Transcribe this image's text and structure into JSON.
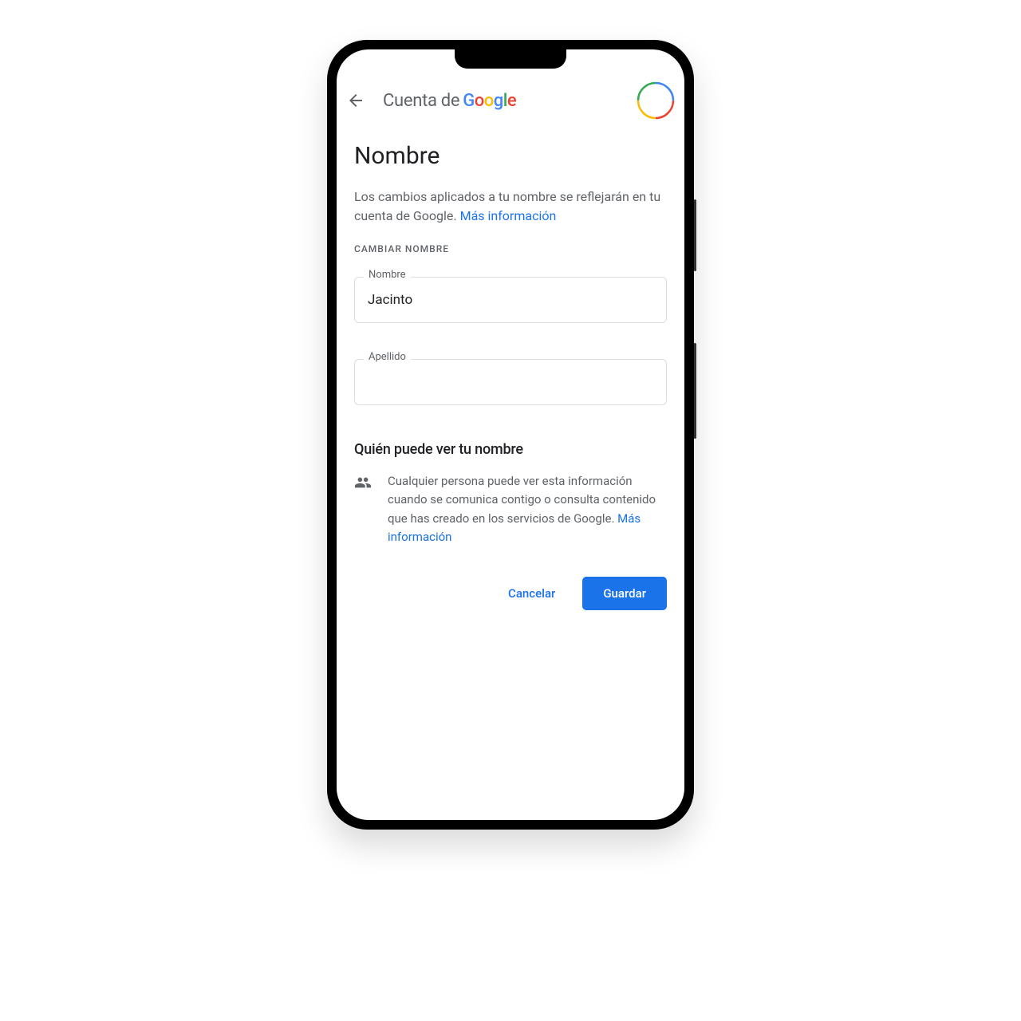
{
  "header": {
    "title_prefix": "Cuenta de ",
    "brand": "Google"
  },
  "page": {
    "title": "Nombre",
    "description": "Los cambios aplicados a tu nombre se reflejarán en tu cuenta de Google. ",
    "more_info_link": "Más información"
  },
  "form": {
    "section_label": "CAMBIAR NOMBRE",
    "first_name": {
      "label": "Nombre",
      "value": "Jacinto"
    },
    "last_name": {
      "label": "Apellido",
      "value": ""
    }
  },
  "visibility": {
    "title": "Quién puede ver tu nombre",
    "text": "Cualquier persona puede ver esta informa­ción cuando se comunica contigo o consulta contenido que has creado en los servicios de Google. ",
    "more_info_link": "Más información"
  },
  "buttons": {
    "cancel": "Cancelar",
    "save": "Guardar"
  }
}
